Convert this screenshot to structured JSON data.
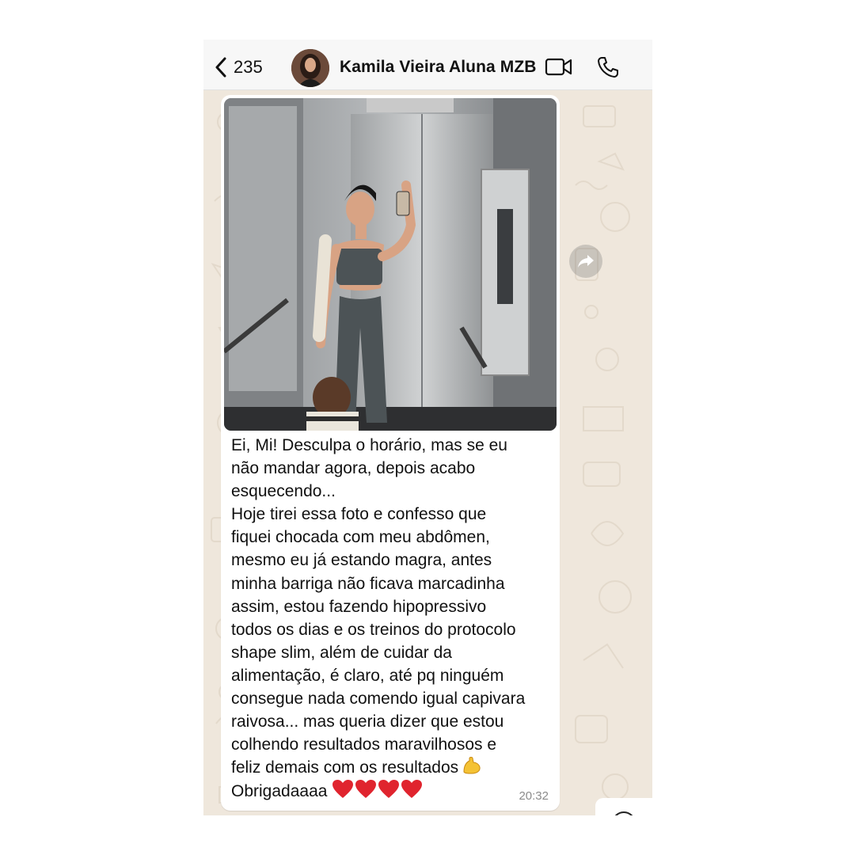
{
  "header": {
    "back_count": "235",
    "contact_name": "Kamila Vieira Aluna MZB"
  },
  "icons": {
    "back": "chevron-left-icon",
    "video": "video-camera-icon",
    "call": "phone-icon",
    "forward": "forward-arrow-icon",
    "heart": "red-heart-emoji",
    "muscle": "flexed-biceps-emoji"
  },
  "message": {
    "lines": [
      "Ei, Mi! Desculpa o horário, mas se eu",
      "não mandar agora, depois acabo",
      "esquecendo...",
      "Hoje tirei essa foto e confesso que",
      "fiquei chocada com meu abdômen,",
      "mesmo eu já estando magra, antes",
      "minha barriga não ficava marcadinha",
      "assim, estou fazendo hipopressivo",
      "todos os dias e os treinos do protocolo",
      "shape slim, além de cuidar da",
      "alimentação, é claro, até pq ninguém",
      "consegue nada comendo igual capivara",
      "raivosa... mas queria dizer que estou",
      "colhendo resultados maravilhosos e",
      "feliz demais com os resultados",
      "Obrigadaaaa"
    ],
    "time": "20:32"
  },
  "colors": {
    "chat_background": "#efe7dc",
    "bubble": "#ffffff",
    "header": "#f7f7f7",
    "heart": "#e0242e",
    "timestamp": "#8b8b8b"
  }
}
